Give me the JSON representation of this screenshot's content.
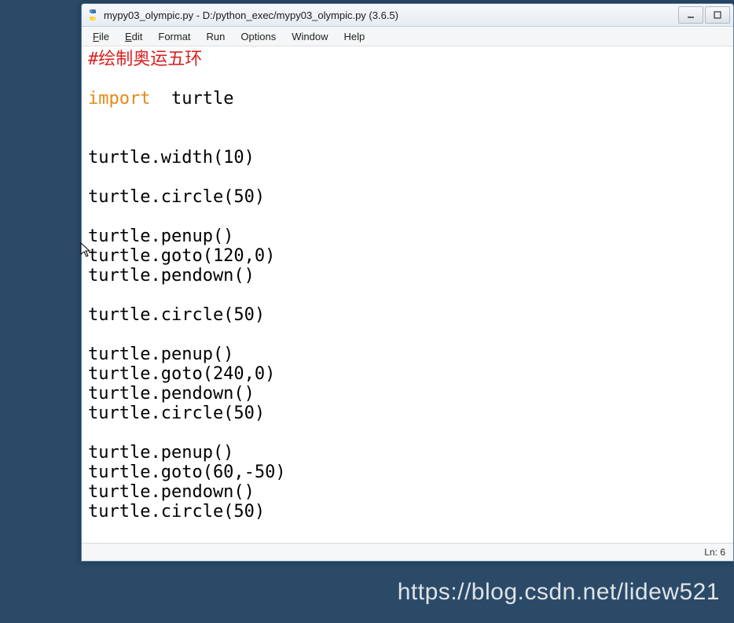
{
  "window": {
    "title": "mypy03_olympic.py - D:/python_exec/mypy03_olympic.py (3.6.5)"
  },
  "menu": {
    "file": "File",
    "edit": "Edit",
    "format": "Format",
    "run": "Run",
    "options": "Options",
    "window": "Window",
    "help": "Help"
  },
  "code": {
    "comment": "#绘制奥运五环",
    "blank1": "",
    "import_kw": "import",
    "import_rest": "  turtle",
    "blank2": "",
    "blank3": "",
    "l_width": "turtle.width(10)",
    "blank4": "",
    "l_c1": "turtle.circle(50)",
    "blank5": "",
    "l_pu1": "turtle.penup()",
    "l_g1": "turtle.goto(120,0)",
    "l_pd1": "turtle.pendown()",
    "blank6": "",
    "l_c2": "turtle.circle(50)",
    "blank7": "",
    "l_pu2": "turtle.penup()",
    "l_g2": "turtle.goto(240,0)",
    "l_pd2": "turtle.pendown()",
    "l_c3": "turtle.circle(50)",
    "blank8": "",
    "l_pu3": "turtle.penup()",
    "l_g3": "turtle.goto(60,-50)",
    "l_pd3": "turtle.pendown()",
    "l_c4": "turtle.circle(50)"
  },
  "status": {
    "line": "Ln: 6"
  },
  "watermark": "https://blog.csdn.net/lidew521"
}
